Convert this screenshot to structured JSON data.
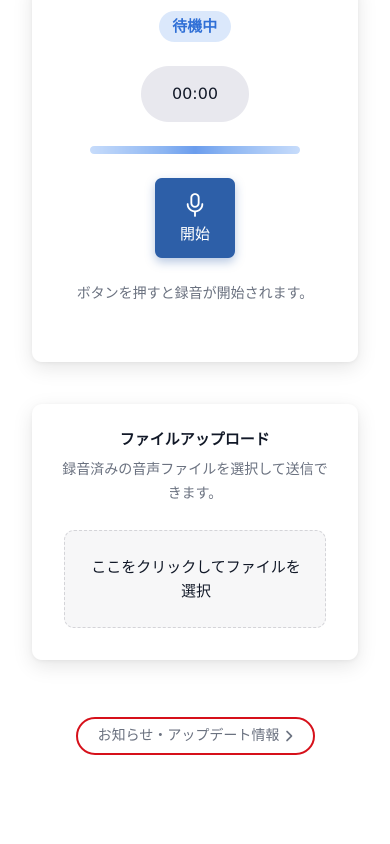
{
  "recorder": {
    "status": "待機中",
    "timer": "00:00",
    "input_level": 0.5,
    "start_button_label": "開始",
    "hint": "ボタンを押すと録音が開始されます。"
  },
  "upload": {
    "title": "ファイルアップロード",
    "description": "録音済みの音声ファイルを選択して送信できます。",
    "dropzone_label": "ここをクリックしてファイルを選択"
  },
  "footer": {
    "news_link_label": "お知らせ・アップデート情報"
  },
  "colors": {
    "accent": "#2d5fa8",
    "badge_bg": "#dbe8fb",
    "badge_text": "#2f6fd6",
    "highlight_outline": "#d6101a"
  },
  "icons": {
    "start": "microphone-icon",
    "news": "chevron-right-icon"
  }
}
